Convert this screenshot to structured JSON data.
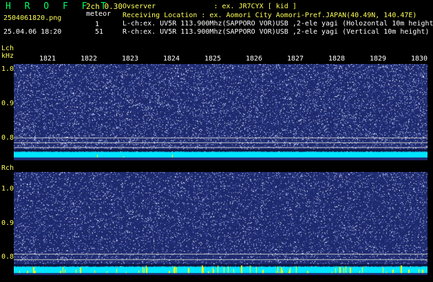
{
  "header": {
    "app_title": "H R O F F T",
    "mode": "2ch 0.30",
    "detection_label": "meteor",
    "filename": "2504061820.png",
    "datetime": "25.04.06 18:20",
    "lch_count": "1",
    "rch_count": "51"
  },
  "info": {
    "observer": "Ovserver              : ex. JR7CYX [ kid ]",
    "location": "Receiving Location : ex. Aomori City Aomori-Pref.JAPAN(40.49N, 140.47E)",
    "lch": "L-ch:ex. UV5R 113.900Mhz(SAPPORO VOR)USB ,2-ele yagi (Holozontal 10m height)",
    "rch": "R-ch:ex. UV5R 113.900Mhz(SAPPORO VOR)USB ,2-ele yagi (Vertical 10m height)"
  },
  "axes": {
    "lch_label": "Lch",
    "rch_label": "Rch",
    "unit": "kHz",
    "x_ticks": [
      "1821",
      "1822",
      "1823",
      "1824",
      "1825",
      "1826",
      "1827",
      "1828",
      "1829",
      "1830"
    ],
    "y_ticks_l": [
      "1.0",
      "0.9",
      "0.8"
    ],
    "y_ticks_r": [
      "1.0",
      "0.9",
      "0.8"
    ]
  },
  "colors": {
    "background": "#000000",
    "noise_bg": "#1e2a6e",
    "speckle": "#b8c8ff",
    "carrier": "#00e5ff",
    "hit": "#ffff00",
    "title": "#00ff66",
    "label": "#ffff55",
    "ref_line": "#c8c8c8"
  }
}
